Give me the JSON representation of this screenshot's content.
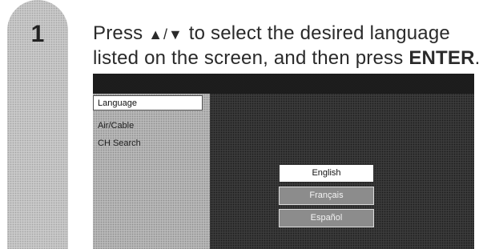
{
  "step": {
    "number": "1"
  },
  "instruction": {
    "prefix": "Press ",
    "arrows": "▲/▼",
    "middle": " to select the desired language listed on the screen, and then press ",
    "key": "ENTER",
    "suffix": "."
  },
  "menu": {
    "items": [
      {
        "label": "Language",
        "selected": true
      },
      {
        "label": "Air/Cable",
        "selected": false
      },
      {
        "label": "CH Search",
        "selected": false
      }
    ]
  },
  "languages": {
    "options": [
      {
        "label": "English",
        "selected": true
      },
      {
        "label": "Français",
        "selected": false
      },
      {
        "label": "Español",
        "selected": false
      }
    ]
  },
  "colors": {
    "screen_background": "#3a3a3a",
    "menu_panel": "#b8b8b8",
    "step_bar": "#c9c9c9",
    "selected_option": "#ffffff"
  }
}
